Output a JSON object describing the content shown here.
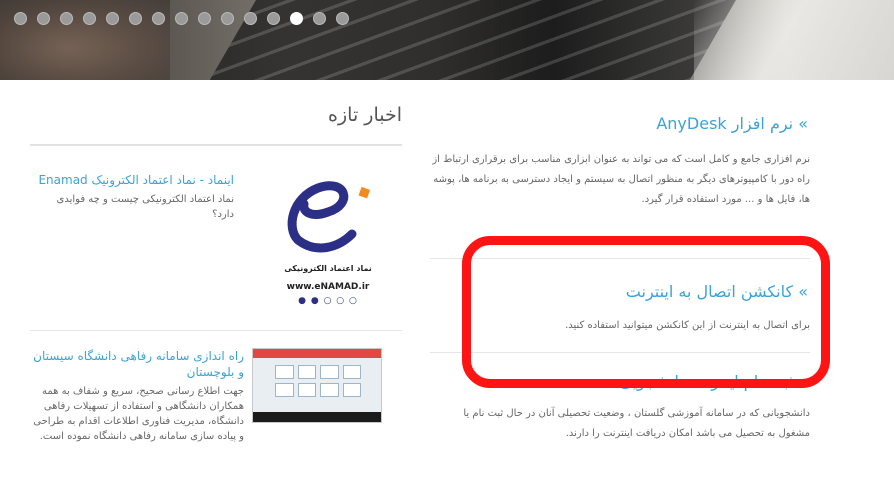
{
  "slider": {
    "dot_count": 15,
    "active_index": 12
  },
  "news": {
    "title": "اخبار تازه",
    "items": [
      {
        "headline": "اینماد - نماد اعتماد الکترونیک Enamad",
        "excerpt": "نماد اعتماد الکترونیکی چیست و چه فوایدی دارد؟"
      },
      {
        "headline": "راه اندازی سامانه رفاهی دانشگاه سیستان و بلوچستان",
        "excerpt": "جهت اطلاع رسانی صحیح، سریع و شفاف به همه همکاران دانشگاهی و استفاده از تسهیلات رفاهی دانشگاه، مدیریت فناوری اطلاعات اقدام به طراحی و پیاده سازی سامانه رفاهی دانشگاه نموده است."
      }
    ],
    "enamad": {
      "caption": "نماد اعتماد الکترونیکی",
      "url": "www.eNAMAD.ir",
      "stars": "● ● ○ ○ ○"
    }
  },
  "sections": [
    {
      "title": "» نرم افزار AnyDesk",
      "body": "نرم افزاری جامع و کامل است که می تواند به عنوان ابزاری مناسب برای برقراری ارتباط از راه دور با کامپیوترهای دیگر به منظور اتصال به سیستم و ایجاد دسترسی به برنامه ها، پوشه ها، فایل ها و ... مورد استفاده قرار گیرد."
    },
    {
      "title": "» کانکشن اتصال به اینترنت",
      "body": "برای اتصال به اینترنت از این کانکشن میتوانید استفاده کنید."
    },
    {
      "title": "» ثبت نام اینترنت دانشجویی",
      "body": "دانشجویانی که در سامانه آموزشی گلستان ، وضعیت تحصیلی آنان در حال ثبت نام یا مشغول به تحصیل می باشد امکان دریافت اینترنت را دارند."
    }
  ],
  "colors": {
    "link": "#3ba3d8",
    "highlight": "#ff1414"
  }
}
